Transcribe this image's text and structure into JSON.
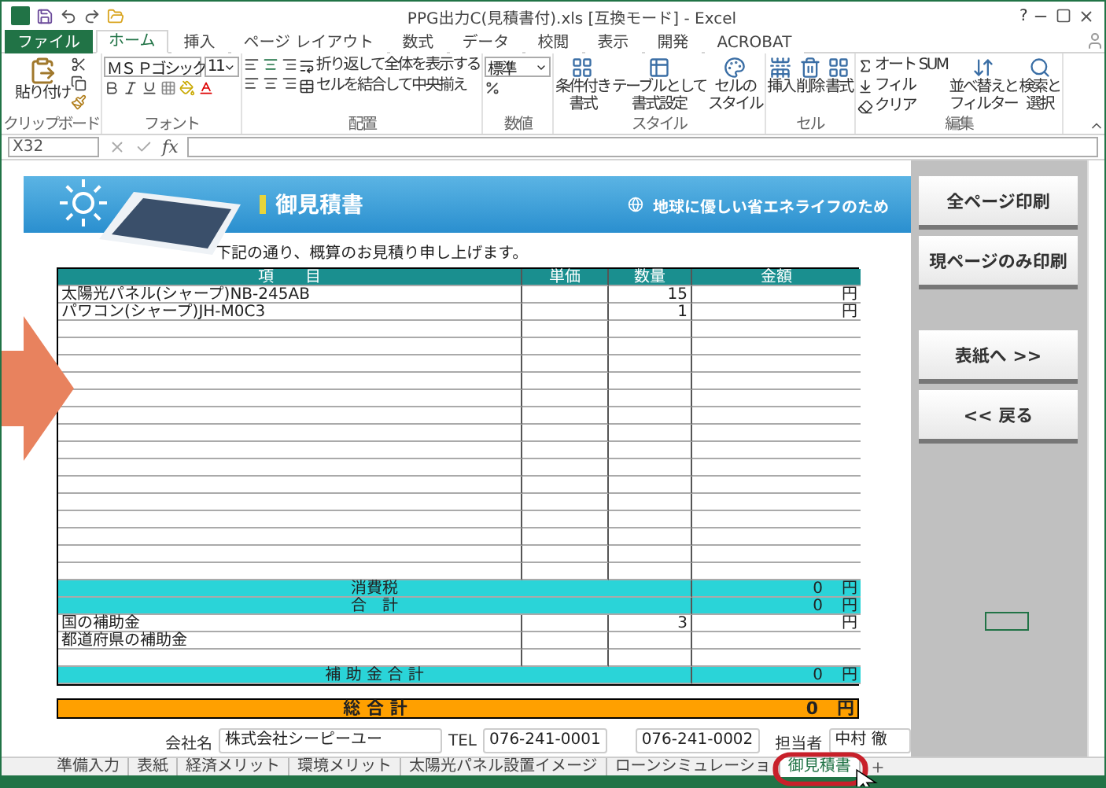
{
  "window": {
    "title": "PPG出力C(見積書付).xls  [互換モード] - Excel",
    "help": "?"
  },
  "ribbon_tabs": [
    {
      "label": "ファイル",
      "kind": "file",
      "selected": false
    },
    {
      "label": "ホーム",
      "kind": "tab",
      "selected": true
    },
    {
      "label": "挿入",
      "kind": "tab",
      "selected": false
    },
    {
      "label": "ページ レイアウト",
      "kind": "tab",
      "selected": false
    },
    {
      "label": "数式",
      "kind": "tab",
      "selected": false
    },
    {
      "label": "データ",
      "kind": "tab",
      "selected": false
    },
    {
      "label": "校閲",
      "kind": "tab",
      "selected": false
    },
    {
      "label": "表示",
      "kind": "tab",
      "selected": false
    },
    {
      "label": "開発",
      "kind": "tab",
      "selected": false
    },
    {
      "label": "ACROBAT",
      "kind": "tab",
      "selected": false
    }
  ],
  "ribbon_groups": [
    {
      "kind": "clipboard",
      "label": "クリップボード",
      "buttons": [
        "貼り付け"
      ]
    },
    {
      "kind": "font",
      "label": "フォント",
      "font_name": "ＭＳ Ｐゴシック",
      "font_size": "11"
    },
    {
      "kind": "alignment",
      "label": "配置",
      "buttons": [
        "折り返して全体を表示する",
        "セルを結合して中央揃え"
      ]
    },
    {
      "kind": "number",
      "label": "数値",
      "format": "標準"
    },
    {
      "kind": "large",
      "label": "スタイル",
      "buttons": [
        {
          "lines": [
            "条件付き",
            "書式"
          ]
        },
        {
          "lines": [
            "テーブルとして",
            "書式設定"
          ]
        },
        {
          "lines": [
            "セルの",
            "スタイル"
          ]
        }
      ]
    },
    {
      "kind": "large",
      "label": "セル",
      "buttons": [
        {
          "lines": [
            "挿入"
          ]
        },
        {
          "lines": [
            "削除"
          ]
        },
        {
          "lines": [
            "書式"
          ]
        }
      ]
    },
    {
      "kind": "editing",
      "label": "編集",
      "small": [
        "オート SUM",
        "フィル",
        "クリア"
      ],
      "buttons": [
        {
          "lines": [
            "並べ替えと",
            "フィルター"
          ]
        },
        {
          "lines": [
            "検索と",
            "選択"
          ]
        }
      ]
    }
  ],
  "formula_bar": {
    "name_box": "X32",
    "function_label": "fx"
  },
  "sheet": {
    "banner_title": "御見積書",
    "banner_tagline": "地球に優しい省エネライフのため",
    "intro": "下記の通り、概算のお見積り申し上げます。",
    "columns": [
      "項　　目",
      "単価",
      "数量",
      "金額"
    ],
    "items": [
      {
        "name": "太陽光パネル(シャープ)NB-245AB",
        "qty": "15",
        "unit": "円"
      },
      {
        "name": "パワコン(シャープ)JH-M0C3",
        "qty": "1",
        "unit": "円"
      }
    ],
    "summary": [
      {
        "kind": "total",
        "label": "消費税",
        "amount": "0",
        "unit": "円"
      },
      {
        "kind": "total",
        "label": "合　計",
        "amount": "0",
        "unit": "円"
      },
      {
        "kind": "line",
        "label": "国の補助金",
        "qty": "3",
        "unit": "円"
      },
      {
        "kind": "line",
        "label": "都道府県の補助金"
      },
      {
        "kind": "blank"
      },
      {
        "kind": "total",
        "label": "補 助 金 合 計",
        "amount": "0",
        "unit": "円"
      }
    ],
    "grand_total": {
      "label": "総 合 計",
      "amount": "0",
      "unit": "円"
    },
    "company": {
      "company_label": "会社名",
      "company": "株式会社シーピーユー",
      "tel_label": "TEL",
      "tel": "076-241-0001",
      "fax": "076-241-0002",
      "staff_label": "担当者",
      "staff": "中村 徹"
    },
    "side_buttons": [
      "全ページ印刷",
      "現ページのみ印刷",
      "表紙へ >>",
      "<< 戻る"
    ]
  },
  "sheet_tabs": [
    {
      "label": "準備入力",
      "selected": false
    },
    {
      "label": "表紙",
      "selected": false
    },
    {
      "label": "経済メリット",
      "selected": false
    },
    {
      "label": "環境メリット",
      "selected": false
    },
    {
      "label": "太陽光パネル設置イメージ",
      "selected": false
    },
    {
      "label": "ローンシミュレーショ",
      "selected": false
    },
    {
      "label": "御見積書",
      "selected": true
    }
  ]
}
